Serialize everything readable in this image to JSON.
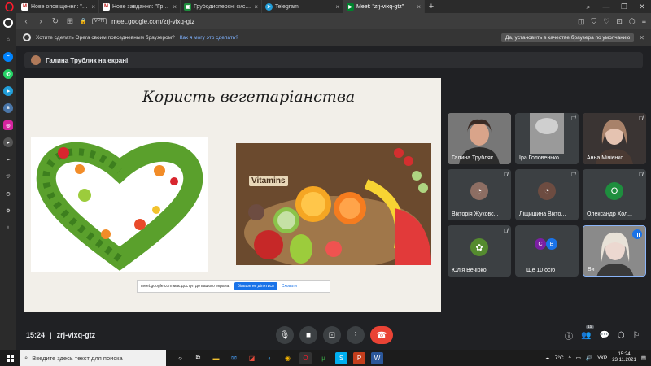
{
  "browser": {
    "tabs": [
      {
        "title": "Нове оповіщення: \"Добр...",
        "icon": "gmail-icon",
        "color": "#c5221f",
        "active": false
      },
      {
        "title": "Нове завдання: \"Грубод...",
        "icon": "gmail-icon",
        "color": "#c5221f",
        "active": false
      },
      {
        "title": "Грубодисперсні системи...",
        "icon": "classroom-icon",
        "color": "#1e8e3e",
        "active": false
      },
      {
        "title": "Telegram",
        "icon": "telegram-icon",
        "color": "#229ed9",
        "active": false
      },
      {
        "title": "Meet: \"zrj-vixq-gtz\"",
        "icon": "meet-icon",
        "color": "#00832d",
        "active": true
      }
    ],
    "url": "meet.google.com/zrj-vixq-gtz",
    "vpn_label": "VPN",
    "promo": {
      "text": "Хотите сделать Opera своим повседневным браузером?",
      "link": "Как я могу это сделать?",
      "accept": "Да, установить в качестве браузера по умолчанию"
    }
  },
  "meet": {
    "presenter_banner": "Галина Трубляк на екрані",
    "slide": {
      "title": "Користь вегетаріанства",
      "vitamins_text": "Vitamins"
    },
    "share_notice": {
      "text": "meet.google.com має доступ до вашого екрана.",
      "stop": "Більше не ділитися",
      "hide": "Сховати"
    },
    "participants": [
      {
        "name": "Галина Трубляк",
        "type": "video",
        "muted": false
      },
      {
        "name": "Іра Головенько",
        "type": "video",
        "muted": true
      },
      {
        "name": "Анна Мічієнко",
        "type": "video",
        "muted": true
      },
      {
        "name": "Вікторія Жуковс...",
        "type": "avatar",
        "muted": true,
        "avatar_color": "#8d6e63"
      },
      {
        "name": "Ліщишина Вікто...",
        "type": "avatar",
        "muted": true,
        "avatar_color": "#6d4c41"
      },
      {
        "name": "Олександр Хол...",
        "type": "letter",
        "muted": true,
        "letter": "О",
        "avatar_color": "#1e8e3e"
      },
      {
        "name": "Юлія Вечірко",
        "type": "avatar",
        "muted": true,
        "avatar_color": "#558b2f"
      },
      {
        "name": "Ще 10 осіб",
        "type": "more",
        "letters": [
          "С",
          "В"
        ],
        "colors": [
          "#7b1fa2",
          "#1a73e8"
        ]
      },
      {
        "name": "Ви",
        "type": "video",
        "muted": false,
        "speaking": true
      }
    ],
    "time": "15:24",
    "meeting_code": "zrj-vixq-gtz",
    "participant_count": "19"
  },
  "taskbar": {
    "search_placeholder": "Введите здесь текст для поиска",
    "weather": "7°C",
    "lang": "УКР",
    "time": "15:24",
    "date": "23.11.2021"
  }
}
